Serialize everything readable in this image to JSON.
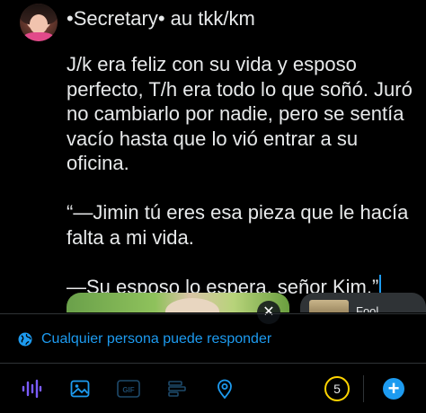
{
  "author": {
    "username": "•Secretary• au tkk/km"
  },
  "composer": {
    "paragraphs": [
      "J/k era feliz con su vida y esposo perfecto, T/h era todo lo que soñó. Juró no cambiarlo por nadie, pero se sentía vacío hasta que lo vió entrar a su oficina.",
      "“—Jimin tú eres esa pieza que le hacía falta a mi vida.",
      "—Su esposo lo espera, señor Kim.”"
    ]
  },
  "media": {
    "close_glyph": "✕",
    "second_label": "Fool"
  },
  "reply_setting": {
    "label": "Cualquier persona puede responder",
    "icon": "globe-icon"
  },
  "toolbar": {
    "icons": [
      "audio-waveform-icon",
      "image-icon",
      "gif-icon",
      "poll-icon",
      "location-icon"
    ],
    "gif_label": "GIF",
    "char_counter": "5",
    "add_glyph": "+"
  },
  "colors": {
    "accent": "#1d9bf0",
    "counter_ring": "#ffd400",
    "text": "#e7e9ea",
    "background": "#000000",
    "divider": "#2f3336"
  }
}
